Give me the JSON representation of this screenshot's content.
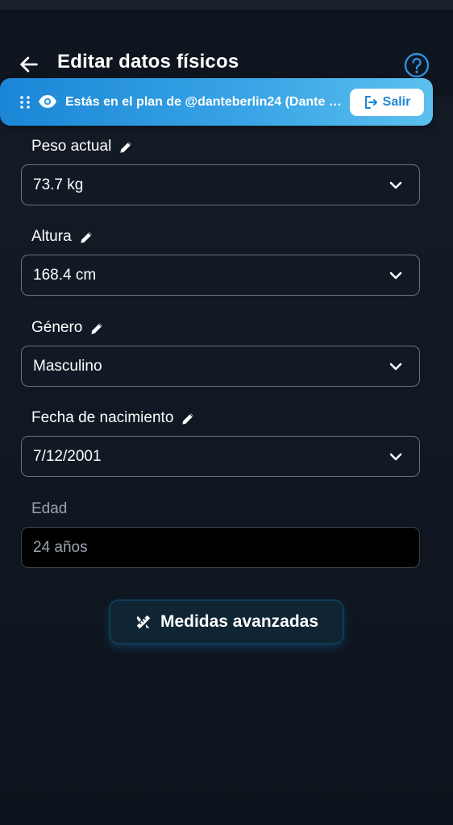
{
  "header": {
    "title": "Editar datos físicos"
  },
  "banner": {
    "text": "Estás en el plan de @danteberlin24 (Dante Be...",
    "exit_label": "Salir"
  },
  "form": {
    "weight": {
      "label": "Peso actual",
      "value": "73.7 kg"
    },
    "height": {
      "label": "Altura",
      "value": "168.4 cm"
    },
    "gender": {
      "label": "Género",
      "value": "Masculino"
    },
    "birthdate": {
      "label": "Fecha de nacimiento",
      "value": "7/12/2001"
    },
    "age": {
      "label": "Edad",
      "value": "24 años"
    }
  },
  "advanced_button": {
    "label": "Medidas avanzadas"
  },
  "icons": [
    "back-arrow-icon",
    "help-circle-icon",
    "drag-handle-icon",
    "eye-icon",
    "logout-icon",
    "pencil-icon",
    "chevron-down-icon",
    "ruler-pencil-icon"
  ],
  "colors": {
    "background": "#111924",
    "banner": "#2f9ee0",
    "accent": "#1b86d6",
    "field_border": "#6a727c"
  }
}
